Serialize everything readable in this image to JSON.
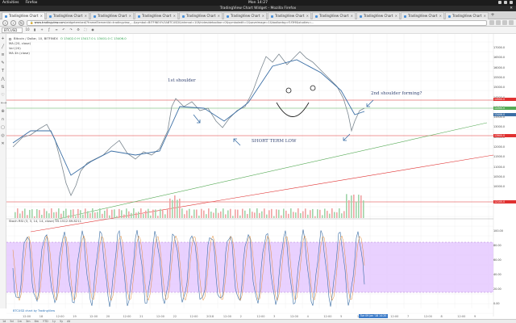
{
  "system": {
    "activities": "Activities",
    "app_menu": "Firefox",
    "clock": "Mon 14:27"
  },
  "window": {
    "title": "TradingView Chart Widget - Mozilla Firefox"
  },
  "tabs": [
    {
      "label": "TradingView Chart Widget"
    },
    {
      "label": "TradingView Chart Widget"
    },
    {
      "label": "TradingView Chart Widget"
    },
    {
      "label": "TradingView Chart Widget"
    },
    {
      "label": "TradingView Chart Widget"
    },
    {
      "label": "TradingView Chart Widget"
    },
    {
      "label": "TradingView Chart Widget"
    },
    {
      "label": "TradingView Chart Widget"
    },
    {
      "label": "TradingView Chart Widget"
    },
    {
      "label": "TradingView Chart Widget"
    },
    {
      "label": "TradingView Chart Widget"
    }
  ],
  "address": {
    "host": "www.tradingview.com",
    "path": "/widgetembed/?frameElementId=tradingview_...&symbol=BITFINEX%3ABTCUSD&interval=10&hidesidetoolbar=0&symboledit=1&saveimage=1&toolbarbg=f1f3f6&studies=..."
  },
  "toolbar": {
    "symbol": "BTCUSD",
    "interval": "10"
  },
  "legend": {
    "title": "Bitcoin / Dollar, 10, BITFINEX",
    "ohlc": "O 13402.0 H 13417.0 L 13401.0 C 13406.0",
    "ma1": "MA (20, close)",
    "ma2": "Vol (20)",
    "ma3": "MA 4h (close)"
  },
  "annotations": {
    "first_shoulder": "1st shoulder",
    "second_shoulder": "2nd shoulder forming?",
    "short_term_low": "SHORT TERM LOW"
  },
  "price_scale": [
    "17000.0",
    "16500.0",
    "16000.0",
    "15500.0",
    "15000.0",
    "14500.0",
    "14000.0",
    "13500.0",
    "13000.0",
    "12500.0",
    "12000.0",
    "11500.0",
    "11000.0",
    "10500.0",
    "10000.0"
  ],
  "price_tags": {
    "red_top": "14500.0",
    "green": "14300.0",
    "red_mid": "13900.0",
    "blue": "13406.0",
    "red_low": "12100.0"
  },
  "oscillator": {
    "label": "Stoch RSI (3, 3, 14, 14, close)",
    "values": "95.1512 89.8211"
  },
  "credit": "BTCUSD chart by TradingView",
  "time_labels": [
    "12:00",
    "18",
    "12:00",
    "19",
    "12:00",
    "20",
    "12:00",
    "21",
    "12:00",
    "22",
    "12:00",
    "2018",
    "12:00",
    "2",
    "12:00",
    "3",
    "12:00",
    "4",
    "12:00",
    "5",
    "12:00",
    "6",
    "12:00",
    "7",
    "12:00",
    "8",
    "12:00",
    "9"
  ],
  "cursor_time": "Tue 09 Jan '18 14:20",
  "status": {
    "items": [
      "1d",
      "5d",
      "1m",
      "3m",
      "6m",
      "YTD",
      "1y",
      "5y",
      "All"
    ]
  },
  "colors": {
    "price_line": "#6b7780",
    "ma_line": "#3a6ea5",
    "stoch_fill": "#d9b3ff",
    "red_line": "#e03030",
    "green_line": "#55aa55"
  }
}
